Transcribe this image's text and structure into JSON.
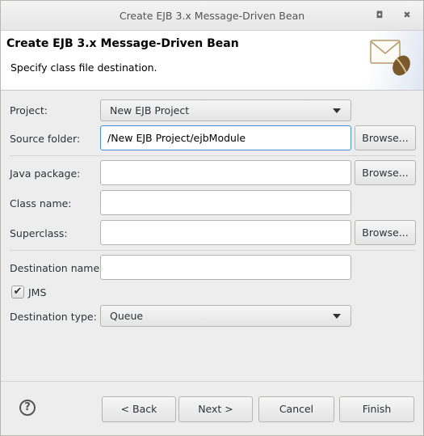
{
  "window": {
    "title": "Create EJB 3.x Message-Driven Bean",
    "maximize_icon": "maximize-icon",
    "close_icon": "close-icon"
  },
  "header": {
    "title": "Create EJB 3.x Message-Driven Bean",
    "subtitle": "Specify class file destination.",
    "icon": "envelope-bean-icon"
  },
  "form": {
    "project": {
      "label": "Project:",
      "value": "New EJB Project"
    },
    "source_folder": {
      "label": "Source folder:",
      "value": "/New EJB Project/ejbModule"
    },
    "java_package": {
      "label": "Java package:",
      "value": ""
    },
    "class_name": {
      "label": "Class name:",
      "value": ""
    },
    "superclass": {
      "label": "Superclass:",
      "value": ""
    },
    "destination_name": {
      "label": "Destination name:",
      "value": ""
    },
    "jms": {
      "label": "JMS",
      "checked": true
    },
    "destination_type": {
      "label": "Destination type:",
      "value": "Queue"
    },
    "browse_label": "Browse..."
  },
  "footer": {
    "back": "< Back",
    "next": "Next >",
    "cancel": "Cancel",
    "finish": "Finish",
    "help": "?"
  }
}
